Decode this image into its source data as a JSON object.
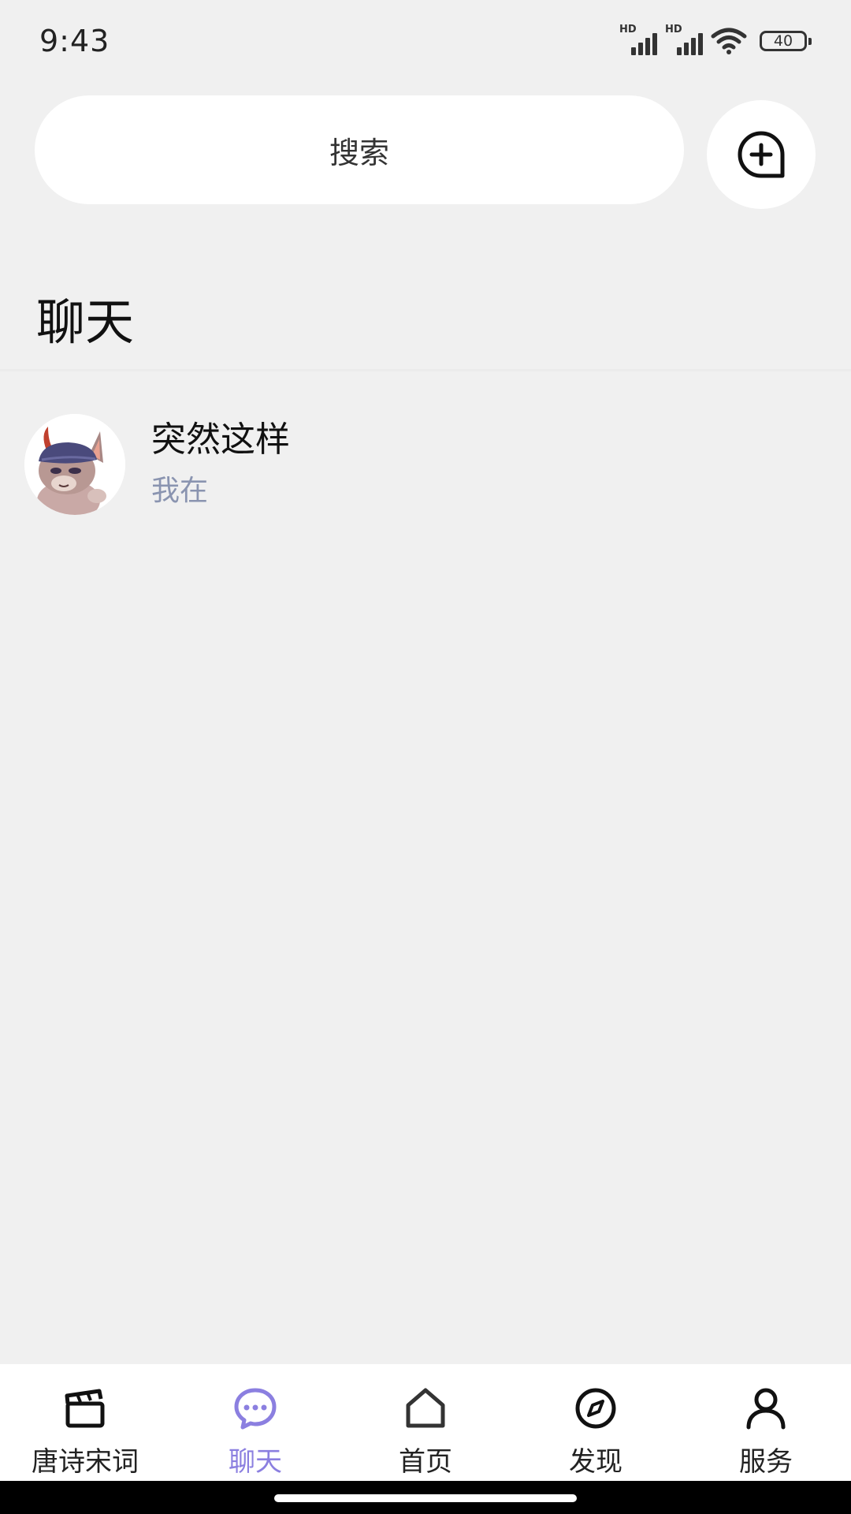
{
  "status_bar": {
    "time": "9:43",
    "signal_1_label": "HD",
    "signal_2_label": "HD",
    "battery": "40"
  },
  "search": {
    "placeholder": "搜索"
  },
  "page": {
    "title": "聊天"
  },
  "chats": [
    {
      "name": "突然这样",
      "preview": "我在",
      "avatar_icon": "cat-character-avatar"
    }
  ],
  "nav": {
    "items": [
      {
        "label": "唐诗宋词",
        "icon": "clapperboard-icon",
        "active": false
      },
      {
        "label": "聊天",
        "icon": "chat-bubble-icon",
        "active": true
      },
      {
        "label": "首页",
        "icon": "home-icon",
        "active": false
      },
      {
        "label": "发现",
        "icon": "compass-icon",
        "active": false
      },
      {
        "label": "服务",
        "icon": "person-icon",
        "active": false
      }
    ]
  },
  "colors": {
    "background": "#f0f0f0",
    "accent": "#8b7fe0",
    "preview_text": "#8a94b0"
  }
}
